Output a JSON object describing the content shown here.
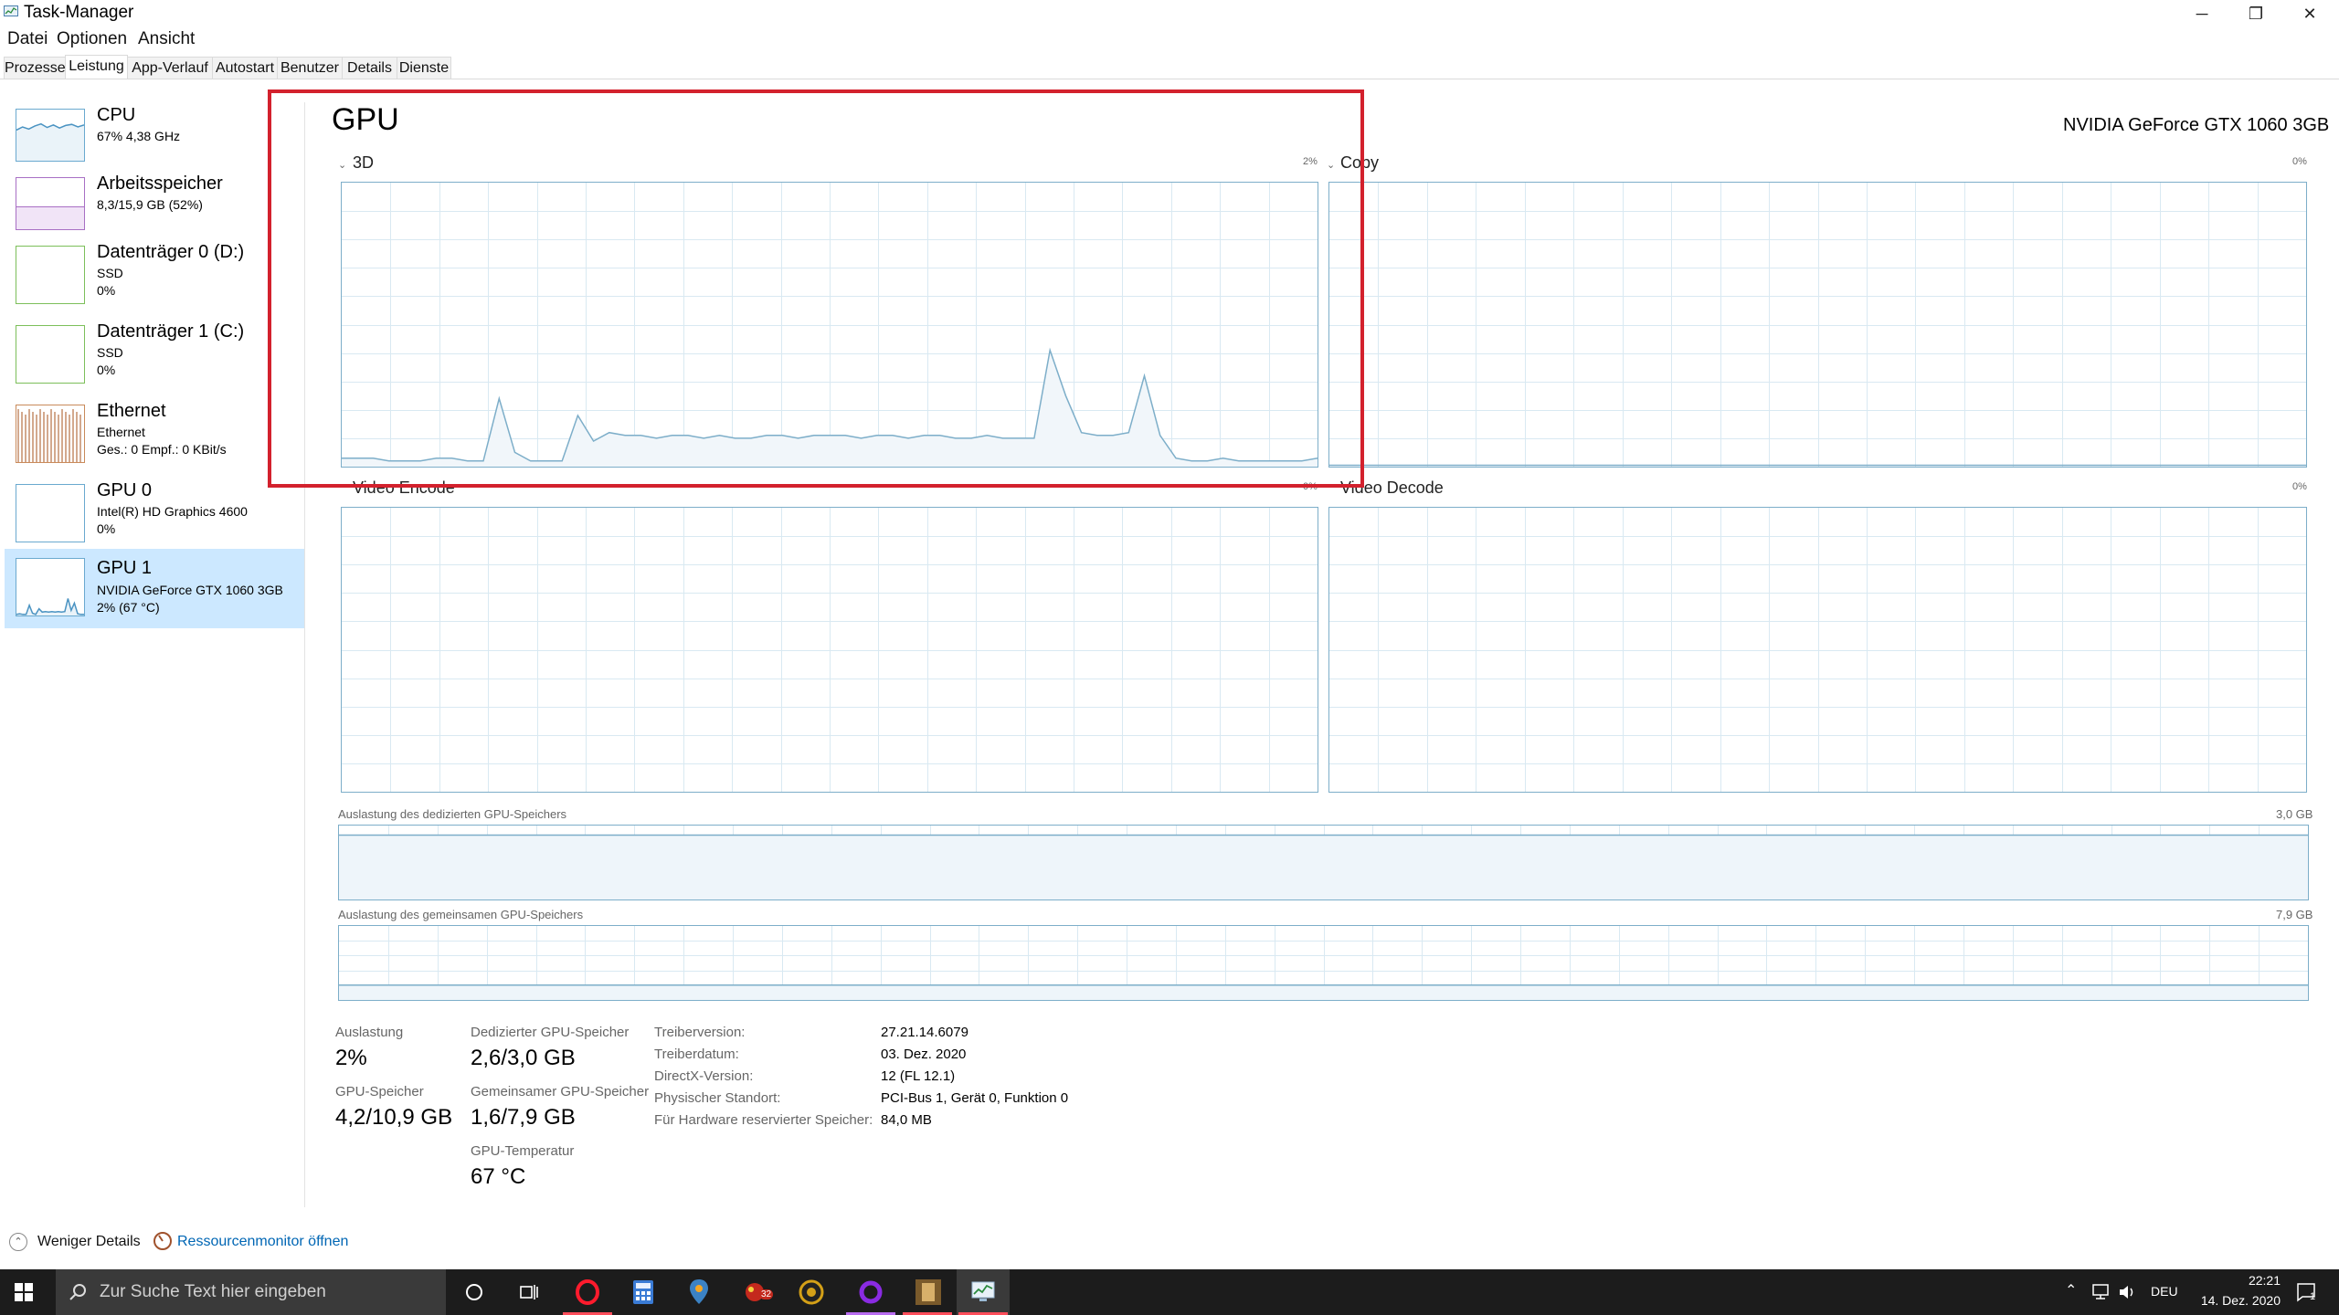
{
  "window": {
    "title": "Task-Manager",
    "controls": {
      "minimize": "─",
      "maximize": "❐",
      "close": "✕"
    }
  },
  "menu": [
    "Datei",
    "Optionen",
    "Ansicht"
  ],
  "tabs": [
    "Prozesse",
    "Leistung",
    "App-Verlauf",
    "Autostart",
    "Benutzer",
    "Details",
    "Dienste"
  ],
  "active_tab": "Leistung",
  "sidebar": {
    "items": [
      {
        "name": "CPU",
        "line1": "67% 4,38 GHz",
        "line2": ""
      },
      {
        "name": "Arbeitsspeicher",
        "line1": "8,3/15,9 GB (52%)",
        "line2": ""
      },
      {
        "name": "Datenträger 0 (D:)",
        "line1": "SSD",
        "line2": "0%"
      },
      {
        "name": "Datenträger 1 (C:)",
        "line1": "SSD",
        "line2": "0%"
      },
      {
        "name": "Ethernet",
        "line1": "Ethernet",
        "line2": "Ges.: 0 Empf.: 0 KBit/s"
      },
      {
        "name": "GPU 0",
        "line1": "Intel(R) HD Graphics 4600",
        "line2": "0%"
      },
      {
        "name": "GPU 1",
        "line1": "NVIDIA GeForce GTX 1060 3GB",
        "line2": "2% (67 °C)"
      }
    ],
    "selected_index": 6
  },
  "main": {
    "title": "GPU",
    "model": "NVIDIA GeForce GTX 1060 3GB",
    "graphs": [
      {
        "label": "3D",
        "percent": "2%"
      },
      {
        "label": "Copy",
        "percent": "0%"
      },
      {
        "label": "Video Encode",
        "percent": "0%"
      },
      {
        "label": "Video Decode",
        "percent": "0%"
      }
    ],
    "dedicated_mem": {
      "label": "Auslastung des dedizierten GPU-Speichers",
      "max": "3,0 GB",
      "fraction": 0.87
    },
    "shared_mem": {
      "label": "Auslastung des gemeinsamen GPU-Speichers",
      "max": "7,9 GB",
      "fraction": 0.2
    },
    "stats": {
      "usage": {
        "label": "Auslastung",
        "value": "2%"
      },
      "dedicated": {
        "label": "Dedizierter GPU-Speicher",
        "value": "2,6/3,0 GB"
      },
      "gpu_mem": {
        "label": "GPU-Speicher",
        "value": "4,2/10,9 GB"
      },
      "shared": {
        "label": "Gemeinsamer GPU-Speicher",
        "value": "1,6/7,9 GB"
      },
      "temp": {
        "label": "GPU-Temperatur",
        "value": "67 °C"
      }
    },
    "info": [
      {
        "k": "Treiberversion:",
        "v": "27.21.14.6079"
      },
      {
        "k": "Treiberdatum:",
        "v": "03. Dez. 2020"
      },
      {
        "k": "DirectX-Version:",
        "v": "12 (FL 12.1)"
      },
      {
        "k": "Physischer Standort:",
        "v": "PCI-Bus 1, Gerät 0, Funktion 0"
      },
      {
        "k": "Für Hardware reservierter Speicher:",
        "v": "84,0 MB"
      }
    ]
  },
  "footer": {
    "fewer_details": "Weniger Details",
    "resource_monitor": "Ressourcenmonitor öffnen"
  },
  "taskbar": {
    "search_placeholder": "Zur Suche Text hier eingeben",
    "language": "DEU",
    "time": "22:21",
    "date": "14. Dez. 2020",
    "notification_count": "1",
    "badge_count": "32"
  },
  "colors": {
    "accent": "#7daec9",
    "selected_bg": "#cce8ff",
    "memory_purple": "#8b3fa8",
    "disk_green": "#4daa23",
    "ethernet_orange": "#a7531d",
    "highlight_red": "#d3212d",
    "taskbar": "#1c1c1c"
  },
  "series": {
    "gpu_3d": [
      3,
      3,
      3,
      2,
      2,
      2,
      3,
      3,
      2,
      2,
      24,
      5,
      2,
      2,
      2,
      18,
      9,
      12,
      11,
      11,
      10,
      11,
      11,
      10,
      11,
      10,
      10,
      11,
      11,
      10,
      11,
      11,
      11,
      10,
      11,
      11,
      10,
      11,
      11,
      10,
      10,
      11,
      10,
      10,
      10,
      41,
      25,
      12,
      11,
      11,
      12,
      32,
      11,
      3,
      2,
      2,
      3,
      2,
      2,
      2,
      2,
      2,
      3
    ],
    "cpu": [
      60,
      66,
      62,
      68,
      72,
      65,
      70,
      64,
      69,
      71,
      66,
      70
    ],
    "gpu1_thumb": [
      2,
      3,
      2,
      2,
      18,
      4,
      2,
      12,
      6,
      7,
      6,
      7,
      6,
      7,
      6,
      7,
      30,
      9,
      22,
      3,
      2,
      2
    ]
  }
}
